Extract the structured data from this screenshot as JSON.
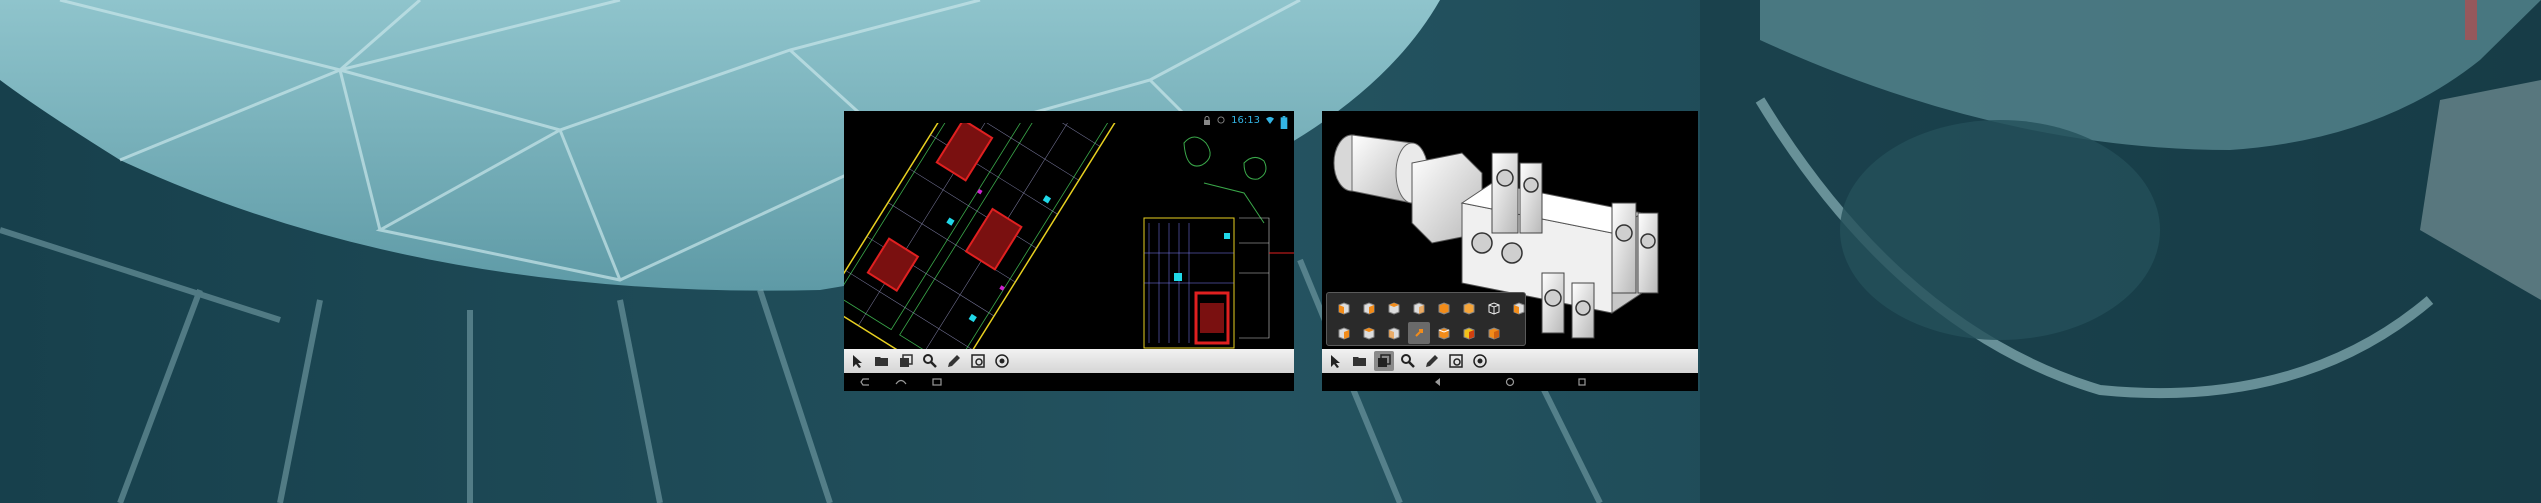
{
  "left_screen": {
    "title": "",
    "status_time": "16:13",
    "toolbar": [
      {
        "name": "select-tool-icon"
      },
      {
        "name": "open-file-icon"
      },
      {
        "name": "layers-icon"
      },
      {
        "name": "zoom-icon"
      },
      {
        "name": "measure-pencil-icon"
      },
      {
        "name": "zoom-window-icon"
      },
      {
        "name": "zoom-extents-icon"
      }
    ],
    "nav": [
      "back-icon",
      "home-icon",
      "recent-apps-icon"
    ]
  },
  "right_screen": {
    "title": "",
    "toolbar": [
      {
        "name": "select-tool-icon"
      },
      {
        "name": "open-file-icon"
      },
      {
        "name": "layers-icon",
        "active": true
      },
      {
        "name": "zoom-icon"
      },
      {
        "name": "measure-pencil-icon"
      },
      {
        "name": "zoom-window-icon"
      },
      {
        "name": "zoom-extents-icon"
      }
    ],
    "view_panel": [
      {
        "name": "view-front-icon"
      },
      {
        "name": "view-back-icon"
      },
      {
        "name": "view-left-icon"
      },
      {
        "name": "view-right-icon"
      },
      {
        "name": "view-top-icon"
      },
      {
        "name": "view-bottom-icon"
      },
      {
        "name": "view-wireframe-icon"
      },
      {
        "name": "view-iso-sw-icon"
      },
      {
        "name": "view-iso-se-icon"
      },
      {
        "name": "view-iso-ne-icon"
      },
      {
        "name": "view-iso-nw-icon"
      },
      {
        "name": "view-orbit-icon",
        "active": true
      },
      {
        "name": "view-pan-icon"
      },
      {
        "name": "view-shaded-icon"
      },
      {
        "name": "view-render-icon"
      }
    ],
    "nav": [
      "back-icon",
      "home-icon",
      "recent-apps-icon"
    ]
  },
  "colors": {
    "background": "#1c4652",
    "accent_orange": "#f28c1a",
    "status_blue": "#33b5e5",
    "cad_red": "#e02020",
    "cad_cyan": "#20d8e8",
    "cad_yellow": "#e8d020"
  }
}
